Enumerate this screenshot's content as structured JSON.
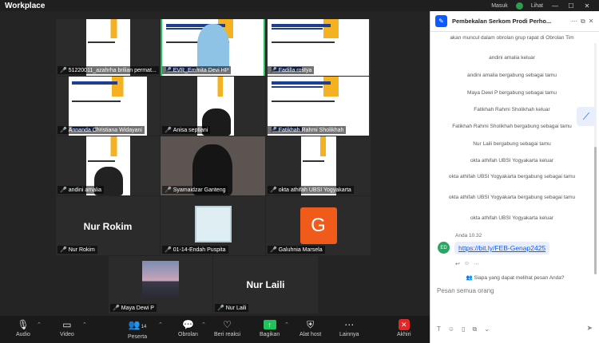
{
  "window": {
    "title": "Workplace",
    "status": "Masuk",
    "menu": "Lihat"
  },
  "gallery": {
    "tiles": [
      {
        "name": "51220011_azahrha brilian permat..."
      },
      {
        "name": "EVR_Emmita Devi HP"
      },
      {
        "name": "Fadilla rostya"
      },
      {
        "name": "Annanda Christiana Widayani"
      },
      {
        "name": "Anisa septiani"
      },
      {
        "name": "Fatikhah Rahmi Sholikhah"
      },
      {
        "name": "andini amalia"
      },
      {
        "name": "Syamaidzar Ganteng"
      },
      {
        "name": "okta athifah UBSI Yogyakarta"
      },
      {
        "name": "Nur Rokim",
        "big": "Nur Rokim"
      },
      {
        "name": "01-14-Endah Puspita"
      },
      {
        "name": "Galuhnia Marsela",
        "initial": "G"
      },
      {
        "name": "Maya Dewi P"
      },
      {
        "name": "Nur Laili",
        "big": "Nur Laili"
      }
    ]
  },
  "toolbar": {
    "audio": "Audio",
    "video": "Video",
    "participants": "Peserta",
    "participants_count": "14",
    "chat": "Obrolan",
    "reactions": "Beri reaksi",
    "share": "Bagikan",
    "host_tools": "Alat host",
    "more": "Lainnya",
    "end": "Akhiri"
  },
  "chat": {
    "title": "Pembekalan Serkom Prodi Perho...",
    "messages": [
      "akan muncul dalam obrolan grup rapat di Obrolan Tim",
      "andini amalia keluar",
      "andini amalia bergabung sebagai tamu",
      "Maya Dewi P bergabung sebagai tamu",
      "Fatikhah Rahmi Sholikhah keluar",
      "Fatikhah Rahmi Sholikhah bergabung sebagai tamu",
      "Nur Laili bergabung sebagai tamu",
      "okta athifah UBSI Yogyakarta keluar",
      "okta athifah UBSI Yogyakarta bergabung sebagai tamu",
      "okta athifah UBSI Yogyakarta bergabung sebagai tamu",
      "okta athifah UBSI Yogyakarta keluar"
    ],
    "sender": "Anda",
    "time": "10.32",
    "avatar_initials": "ED",
    "link": "https://bit.ly/FEB-Genap2425",
    "who_can_see": "Siapa yang dapat melihat pesan Anda?",
    "input_placeholder": "Pesan semua orang"
  },
  "colors": {
    "accent": "#0b5cff",
    "speaker": "#21c45a",
    "end": "#e02828"
  }
}
